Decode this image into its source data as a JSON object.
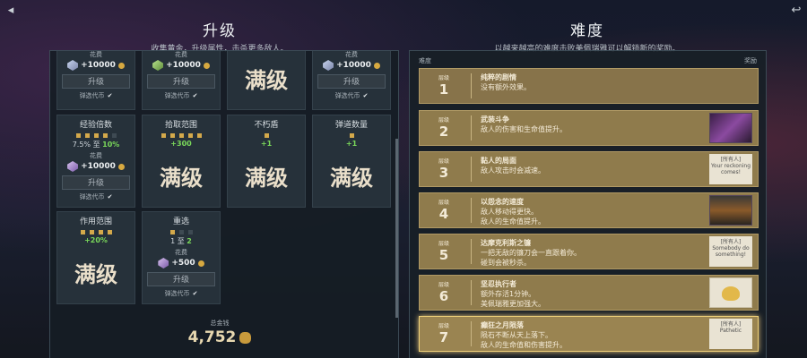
{
  "nav": {
    "back_glyph": "◂",
    "return_glyph": "↩"
  },
  "left": {
    "title": "升级",
    "subtitle": "收集黄金，升级属性，击杀更多敌人。"
  },
  "right": {
    "title": "难度",
    "subtitle": "以越来越高的难度击败美佩瑞雅可以解锁新的奖励。"
  },
  "cards": [
    {
      "cost_label": "花费",
      "cost": "+10000",
      "button": "升级",
      "check": "弹选代币"
    },
    {
      "cost_label": "花费",
      "cost": "+10000",
      "button": "升级",
      "check": "弹选代币"
    },
    {
      "maxed": "满级"
    },
    {
      "cost_label": "花费",
      "cost": "+10000",
      "button": "升级",
      "check": "弹选代币"
    },
    {
      "title": "经验倍数",
      "level_from": "7.5%",
      "level_sep": "至",
      "level_to": "10%",
      "cost_label": "花费",
      "cost": "+10000",
      "button": "升级",
      "check": "弹选代币"
    },
    {
      "title": "拾取范围",
      "gain": "+300",
      "maxed": "满级"
    },
    {
      "title": "不朽盾",
      "gain": "+1",
      "maxed": "满级"
    },
    {
      "title": "弹道数量",
      "gain": "+1",
      "maxed": "满级"
    },
    {
      "title": "作用范围",
      "gain": "+20%",
      "maxed": "满级"
    },
    {
      "title": "重选",
      "level_from": "1",
      "level_sep": "至",
      "level_to": "2",
      "cost_label": "花费",
      "cost": "+500",
      "button": "升级",
      "check": "弹选代币"
    }
  ],
  "total": {
    "label": "总金钱",
    "value": "4,752"
  },
  "difficulty": {
    "col_left": "难度",
    "col_right": "奖励",
    "rows": [
      {
        "label": "层级",
        "num": "1",
        "name": "纯粹的剧情",
        "desc": "没有额外效果。"
      },
      {
        "label": "层级",
        "num": "2",
        "name": "武装斗争",
        "desc": "敌人的伤害和生命值提升。"
      },
      {
        "label": "层级",
        "num": "3",
        "name": "黏人的局面",
        "desc": "敌人攻击时会减速。",
        "reward": "[所有人]\nYour reckoning\ncomes!"
      },
      {
        "label": "层级",
        "num": "4",
        "name": "以怨念的速度",
        "desc": "敌人移动得更快。\n敌人的生命值提升。"
      },
      {
        "label": "层级",
        "num": "5",
        "name": "达摩克利斯之镰",
        "desc": "一把无敌的镰刀会一直跟着你。\n碰到会被秒杀。",
        "reward": "[所有人]\nSomebody do\nsomething!"
      },
      {
        "label": "层级",
        "num": "6",
        "name": "坚忍执行者",
        "desc": "额外存活1分钟。\n美佩瑞雅更加强大。"
      },
      {
        "label": "层级",
        "num": "7",
        "name": "癫狂之月陨落",
        "desc": "陨石不断从天上落下。\n敌人的生命值和伤害提升。",
        "reward": "[所有人]\nPathetic"
      }
    ]
  },
  "colors": {
    "gold_row": "#8f7b4c",
    "selected_glow": "#f0d27a",
    "green": "#7ad85a"
  }
}
